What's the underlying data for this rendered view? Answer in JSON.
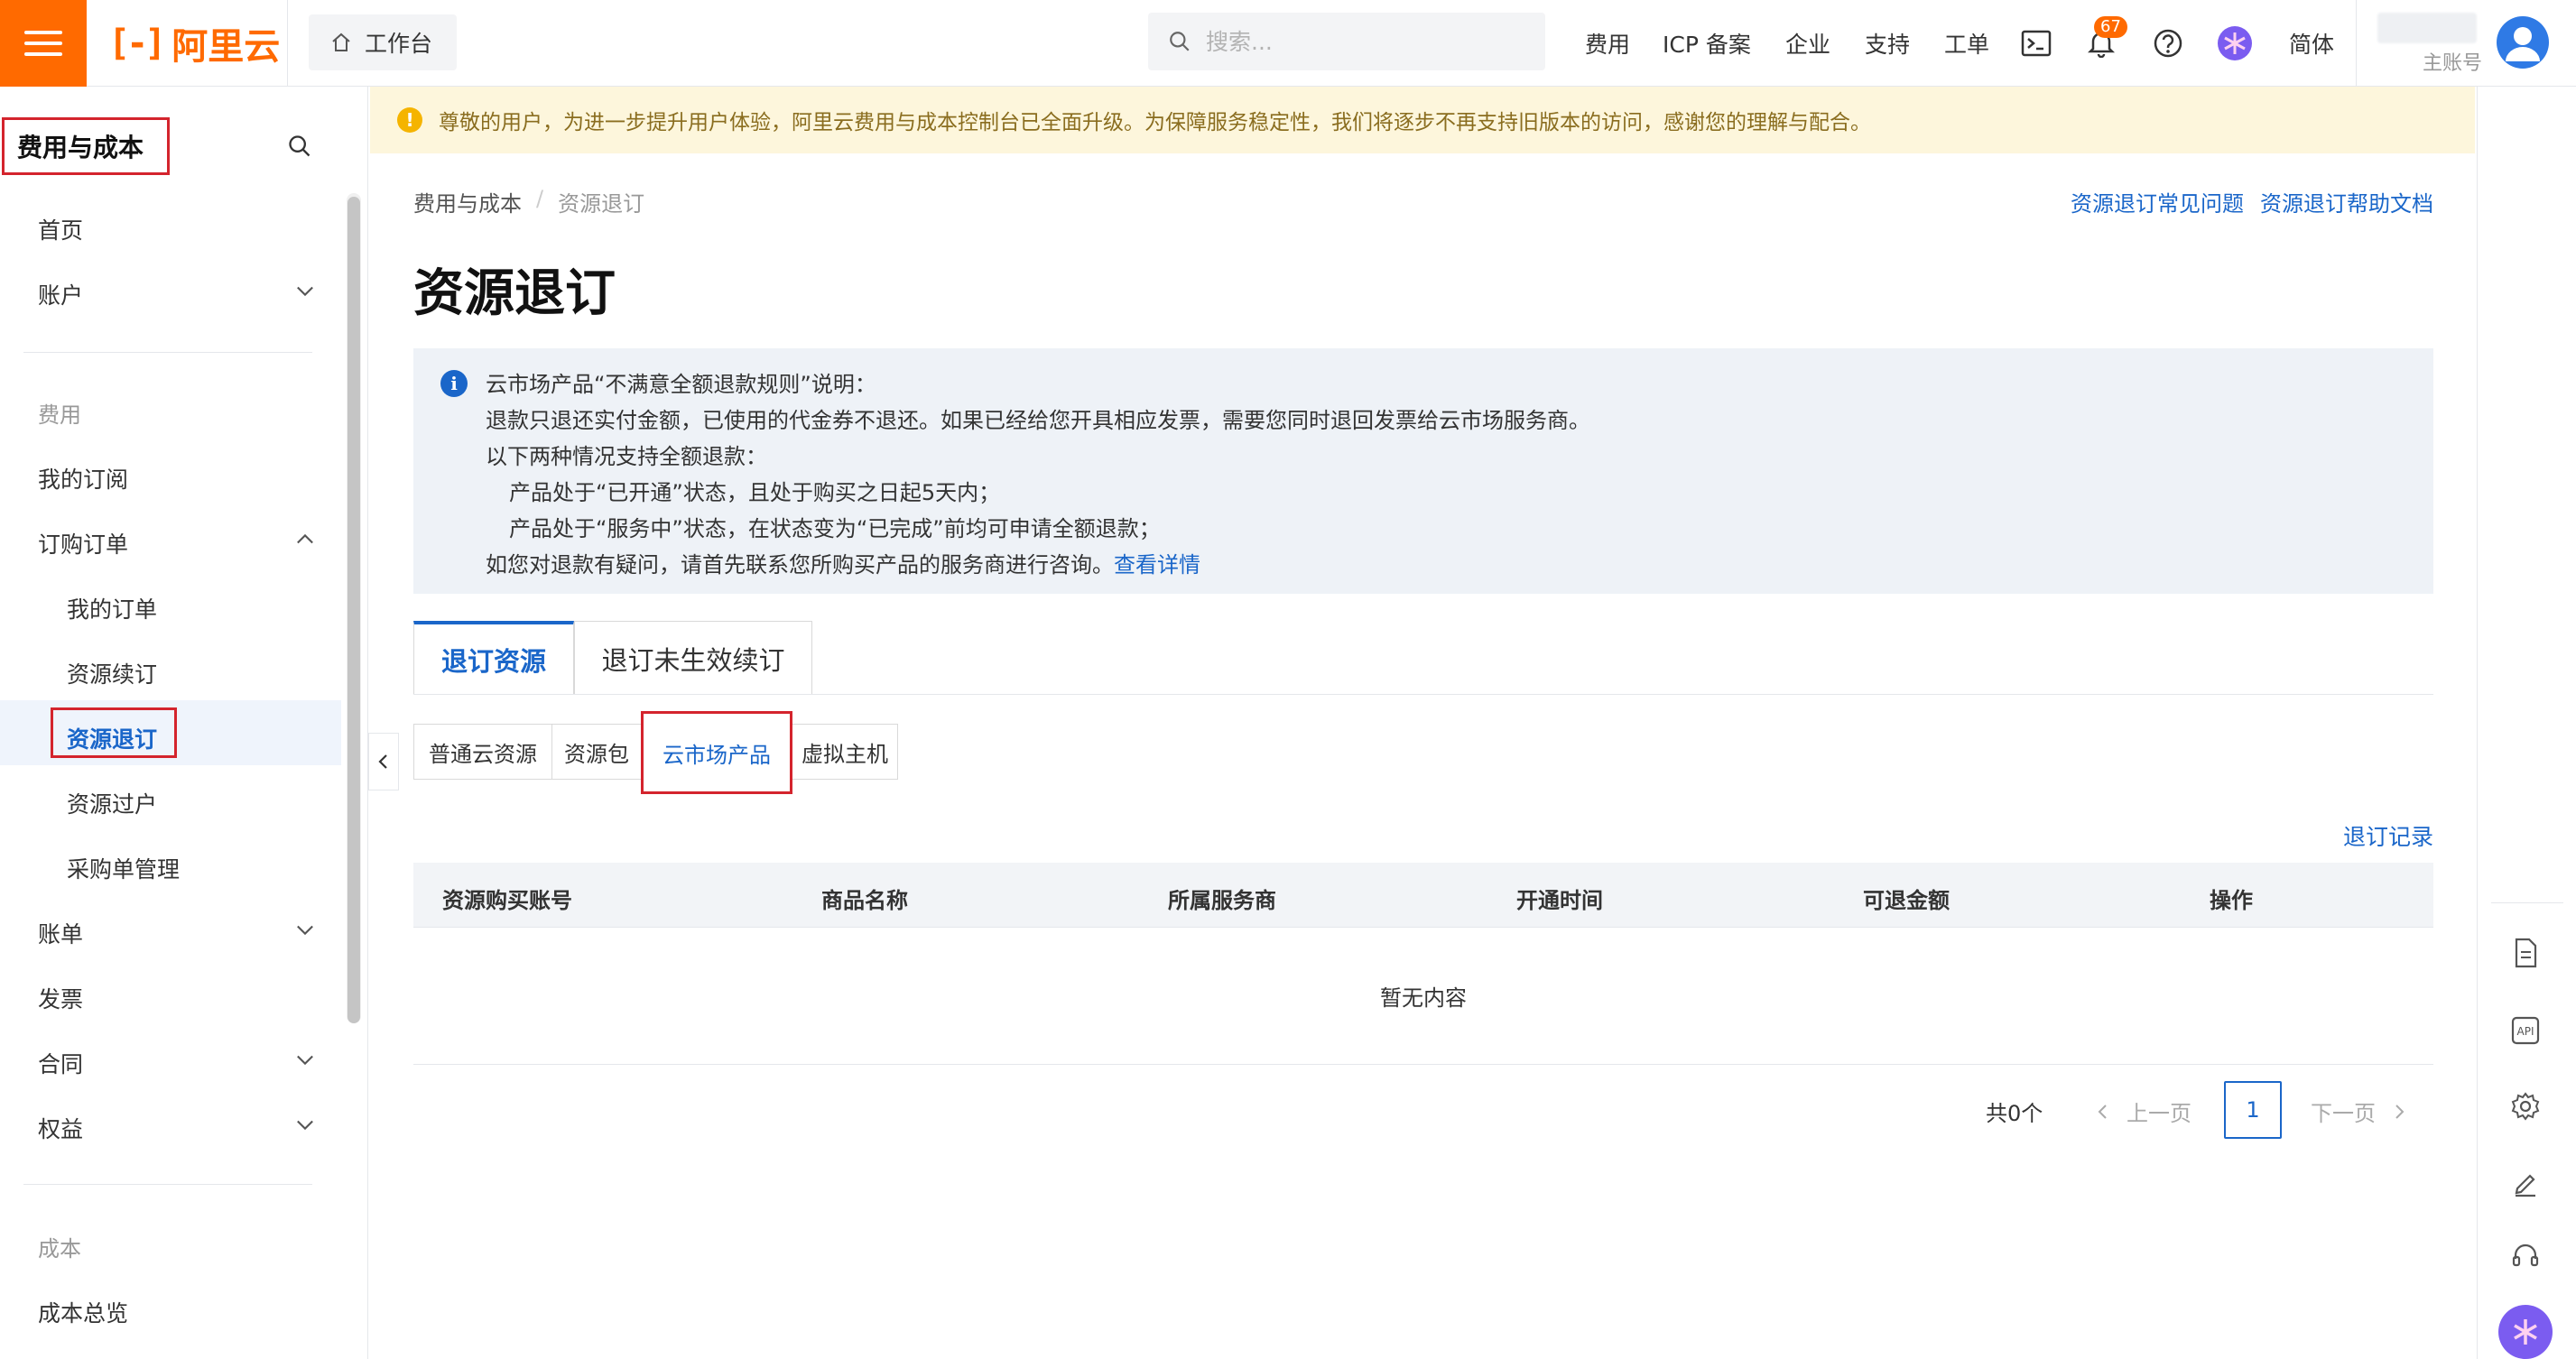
{
  "header": {
    "logo_text": "阿里云",
    "logo_mark": "[-]",
    "workbench": "工作台",
    "search_placeholder": "搜索...",
    "nav": [
      "费用",
      "ICP 备案",
      "企业",
      "支持",
      "工单"
    ],
    "notification_count": "67",
    "language": "简体",
    "account_type": "主账号"
  },
  "sidebar": {
    "title": "费用与成本",
    "items": {
      "home": "首页",
      "account": "账户",
      "group_fee": "费用",
      "my_subscription": "我的订阅",
      "purchase_orders": "订购订单",
      "my_orders": "我的订单",
      "renew": "资源续订",
      "unsubscribe": "资源退订",
      "transfer": "资源过户",
      "procurement": "采购单管理",
      "bill": "账单",
      "invoice": "发票",
      "contract": "合同",
      "benefits": "权益",
      "group_cost": "成本",
      "cost_overview": "成本总览"
    }
  },
  "banner": {
    "text": "尊敬的用户，为进一步提升用户体验，阿里云费用与成本控制台已全面升级。为保障服务稳定性，我们将逐步不再支持旧版本的访问，感谢您的理解与配合。"
  },
  "breadcrumb": {
    "root": "费用与成本",
    "sep": "/",
    "current": "资源退订"
  },
  "help_links": [
    "资源退订常见问题",
    "资源退订帮助文档"
  ],
  "page_title": "资源退订",
  "notice": {
    "line1": "云市场产品“不满意全额退款规则”说明：",
    "line2": "退款只退还实付金额，已使用的代金券不退还。如果已经给您开具相应发票，需要您同时退回发票给云市场服务商。",
    "line3": "以下两种情况支持全额退款：",
    "line4": "产品处于“已开通”状态，且处于购买之日起5天内；",
    "line5": "产品处于“服务中”状态，在状态变为“已完成”前均可申请全额退款；",
    "line6": "如您对退款有疑问，请首先联系您所购买产品的服务商进行咨询。",
    "link": "查看详情"
  },
  "tabs": [
    "退订资源",
    "退订未生效续订"
  ],
  "subtabs": [
    "普通云资源",
    "资源包",
    "云市场产品",
    "虚拟主机"
  ],
  "record_link": "退订记录",
  "table": {
    "columns": [
      "资源购买账号",
      "商品名称",
      "所属服务商",
      "开通时间",
      "可退金额",
      "操作"
    ],
    "empty_text": "暂无内容"
  },
  "pagination": {
    "total": "共0个",
    "prev": "上一页",
    "current": "1",
    "next": "下一页"
  },
  "colors": {
    "brand": "#ff6a00",
    "primary": "#1a66c9",
    "highlight_box": "#d4242d"
  }
}
